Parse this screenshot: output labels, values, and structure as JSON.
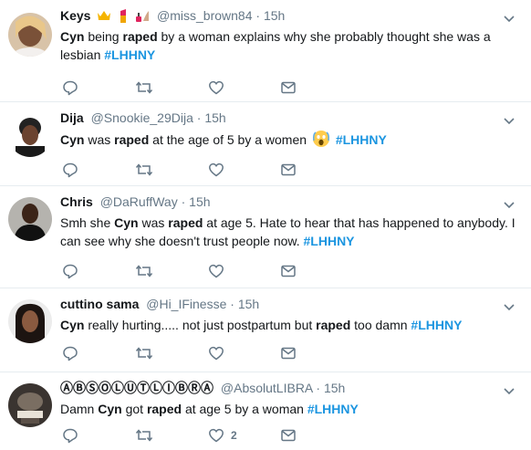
{
  "tweets": [
    {
      "name": "Keys",
      "handle": "@miss_brown84",
      "dot": "·",
      "time": "15h",
      "name_emojis": [
        "crown-emoji",
        "lipstick-emoji",
        "nail-polish-emoji"
      ],
      "text_segments": [
        {
          "t": "Cyn",
          "style": "bold"
        },
        {
          "t": " being ",
          "style": "plain"
        },
        {
          "t": "raped",
          "style": "bold"
        },
        {
          "t": " by a woman explains why she probably thought she was a lesbian ",
          "style": "plain"
        },
        {
          "t": "#LHHNY",
          "style": "hashtag"
        }
      ],
      "like_count": ""
    },
    {
      "name": "Dija",
      "handle": "@Snookie_29Dija",
      "dot": "·",
      "time": "15h",
      "name_emojis": [],
      "text_segments": [
        {
          "t": "Cyn",
          "style": "bold"
        },
        {
          "t": " was ",
          "style": "plain"
        },
        {
          "t": "raped",
          "style": "bold"
        },
        {
          "t": " at the age of 5 by a women ",
          "style": "plain"
        },
        {
          "t": "screaming-face-emoji",
          "style": "emoji"
        },
        {
          "t": " ",
          "style": "plain"
        },
        {
          "t": "#LHHNY",
          "style": "hashtag"
        }
      ],
      "like_count": ""
    },
    {
      "name": "Chris",
      "handle": "@DaRuffWay",
      "dot": "·",
      "time": "15h",
      "name_emojis": [],
      "text_segments": [
        {
          "t": "Smh she ",
          "style": "plain"
        },
        {
          "t": "Cyn",
          "style": "bold"
        },
        {
          "t": " was ",
          "style": "plain"
        },
        {
          "t": "raped",
          "style": "bold"
        },
        {
          "t": " at age 5. Hate to hear that has happened to anybody. I can see why she doesn't trust people now. ",
          "style": "plain"
        },
        {
          "t": "#LHHNY",
          "style": "hashtag"
        }
      ],
      "like_count": ""
    },
    {
      "name": "cuttino sama",
      "handle": "@Hi_IFinesse",
      "dot": "·",
      "time": "15h",
      "name_emojis": [],
      "text_segments": [
        {
          "t": "Cyn",
          "style": "bold"
        },
        {
          "t": " really hurting..... not just postpartum but ",
          "style": "plain"
        },
        {
          "t": "raped",
          "style": "bold"
        },
        {
          "t": " too damn  ",
          "style": "plain"
        },
        {
          "t": "#LHHNY",
          "style": "hashtag"
        }
      ],
      "like_count": ""
    },
    {
      "name": "ⒶⒷⓈⓄⓁⓊⓉⓁⒾⒷⓇⒶ",
      "handle": "@AbsolutLIBRA",
      "dot": "·",
      "time": "15h",
      "name_emojis": [],
      "text_segments": [
        {
          "t": "Damn ",
          "style": "plain"
        },
        {
          "t": "Cyn",
          "style": "bold"
        },
        {
          "t": " got ",
          "style": "plain"
        },
        {
          "t": "raped",
          "style": "bold"
        },
        {
          "t": "  at age 5 by a woman ",
          "style": "plain"
        },
        {
          "t": "#LHHNY",
          "style": "hashtag"
        }
      ],
      "like_count": "2"
    }
  ],
  "colors": {
    "hashtag": "#1b95e0",
    "muted": "#657786",
    "divider": "#e6ecf0"
  },
  "icons": {
    "reply": "reply-icon",
    "retweet": "retweet-icon",
    "like": "like-icon",
    "message": "direct-message-icon",
    "menu": "chevron-down-icon"
  }
}
